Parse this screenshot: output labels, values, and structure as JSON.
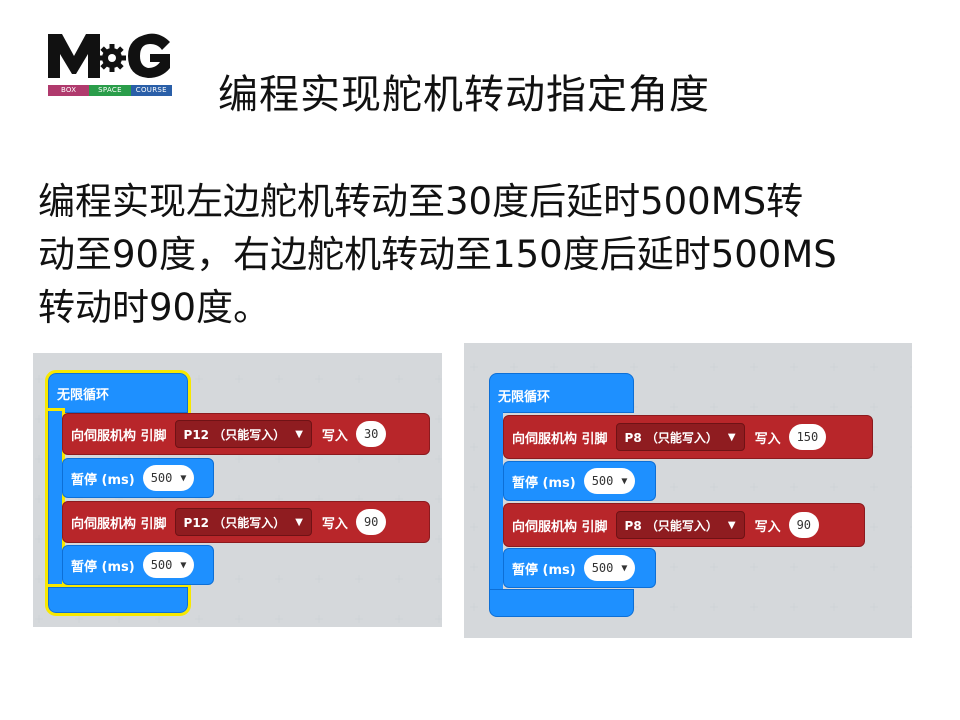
{
  "logo": {
    "bar_words": [
      "BOX",
      "SPACE",
      "COURSE"
    ],
    "bar_colors": [
      "#b03a6d",
      "#2a9d4a",
      "#2a5fa8"
    ]
  },
  "title": "编程实现舵机转动指定角度",
  "description_lines": [
    "编程实现左边舵机转动至30度后延时500MS转",
    "动至90度，右边舵机转动至150度后延时500MS",
    "转动时90度。"
  ],
  "colors": {
    "loop_blue": "#1e90ff",
    "servo_red": "#b8262a",
    "selection_yellow": "#f7e800",
    "workspace_bg": "#ecedee"
  },
  "left_program": {
    "forever_label": "无限循环",
    "blocks": [
      {
        "type": "servo",
        "label": "向伺服机构 引脚",
        "pin": "P12 （只能写入）",
        "write_label": "写入",
        "value": "30"
      },
      {
        "type": "pause",
        "label": "暂停 (ms)",
        "value": "500"
      },
      {
        "type": "servo",
        "label": "向伺服机构 引脚",
        "pin": "P12 （只能写入）",
        "write_label": "写入",
        "value": "90"
      },
      {
        "type": "pause",
        "label": "暂停 (ms)",
        "value": "500"
      }
    ]
  },
  "right_program": {
    "forever_label": "无限循环",
    "blocks": [
      {
        "type": "servo",
        "label": "向伺服机构 引脚",
        "pin": "P8 （只能写入）",
        "write_label": "写入",
        "value": "150"
      },
      {
        "type": "pause",
        "label": "暂停 (ms)",
        "value": "500"
      },
      {
        "type": "servo",
        "label": "向伺服机构 引脚",
        "pin": "P8 （只能写入）",
        "write_label": "写入",
        "value": "90"
      },
      {
        "type": "pause",
        "label": "暂停 (ms)",
        "value": "500"
      }
    ]
  }
}
